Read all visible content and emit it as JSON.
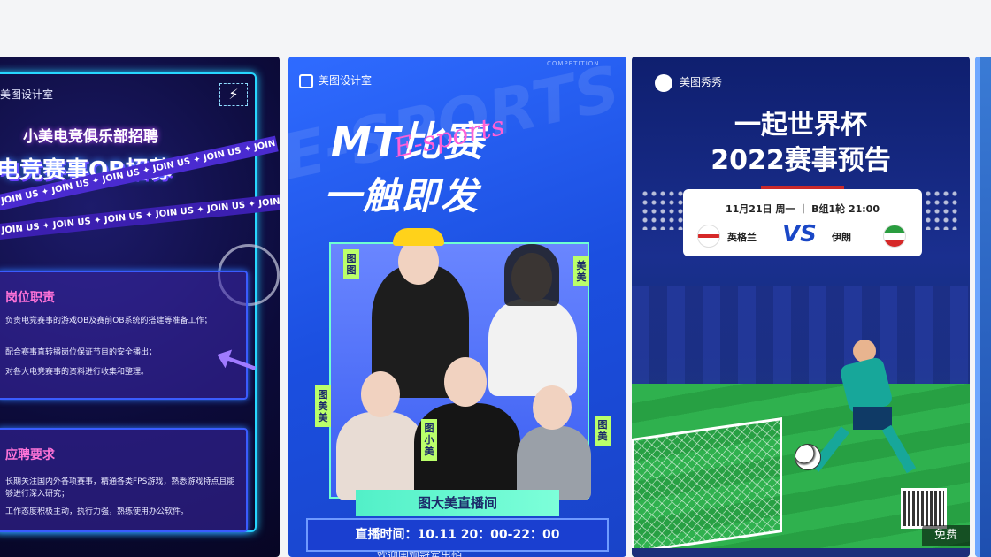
{
  "cards": [
    {
      "brand": "美图设计室",
      "title_small": "小美电竞俱乐部招聘",
      "title_big": "电竞赛事OB招募",
      "tape_text": "✦ JOIN US ✦ JOIN US ✦ JOIN US ✦ JOIN US ✦ JOIN US ✦ JOIN US ✦ JOIN US",
      "section1_title": "岗位职责",
      "section1_lines": [
        "负责电竞赛事的游戏OB及赛前OB系统的搭建等准备工作；",
        "配合赛事直转播岗位保证节目的安全播出；",
        "对各大电竞赛事的资料进行收集和整理。"
      ],
      "section2_title": "应聘要求",
      "section2_lines": [
        "长期关注国内外各项赛事，精通各类FPS游戏，熟悉游戏特点且能够进行深入研究；",
        "工作态度积极主动，执行力强，熟练使用办公软件。"
      ]
    },
    {
      "brand": "美图设计室",
      "competition": "COMPETITION",
      "bg_word": "E-SPORTS",
      "title_line1": "MT比赛",
      "title_line2": "一触即发",
      "script": "E-sports",
      "tags": [
        "图图",
        "美美",
        "图美美",
        "图小美",
        "图美"
      ],
      "live_room": "图大美直播间",
      "broadcast_time": "直播时间：10.11 20：00-22：00",
      "welcome": "欢迎围观冠军出炉"
    },
    {
      "brand": "美图秀秀",
      "headline1": "一起世界杯",
      "headline2": "2022赛事预告",
      "match_date": "11月21日 周一 丨 B组1轮 21:00",
      "team_left": "英格兰",
      "team_right": "伊朗",
      "vs": "VS",
      "badge_free": "免费"
    }
  ],
  "colors": {
    "page_bg": "#f4f5f7",
    "neon_cyan": "#27d7ff",
    "neon_pink": "#ff73d8",
    "mt_blue": "#2f6bff",
    "lime": "#baff6a",
    "pitch_green": "#2db34a"
  },
  "icons": [
    "lightning-icon",
    "meitu-logo-icon",
    "meitu-xiuxiu-logo-icon",
    "qr-code-icon",
    "arrow-icon"
  ]
}
